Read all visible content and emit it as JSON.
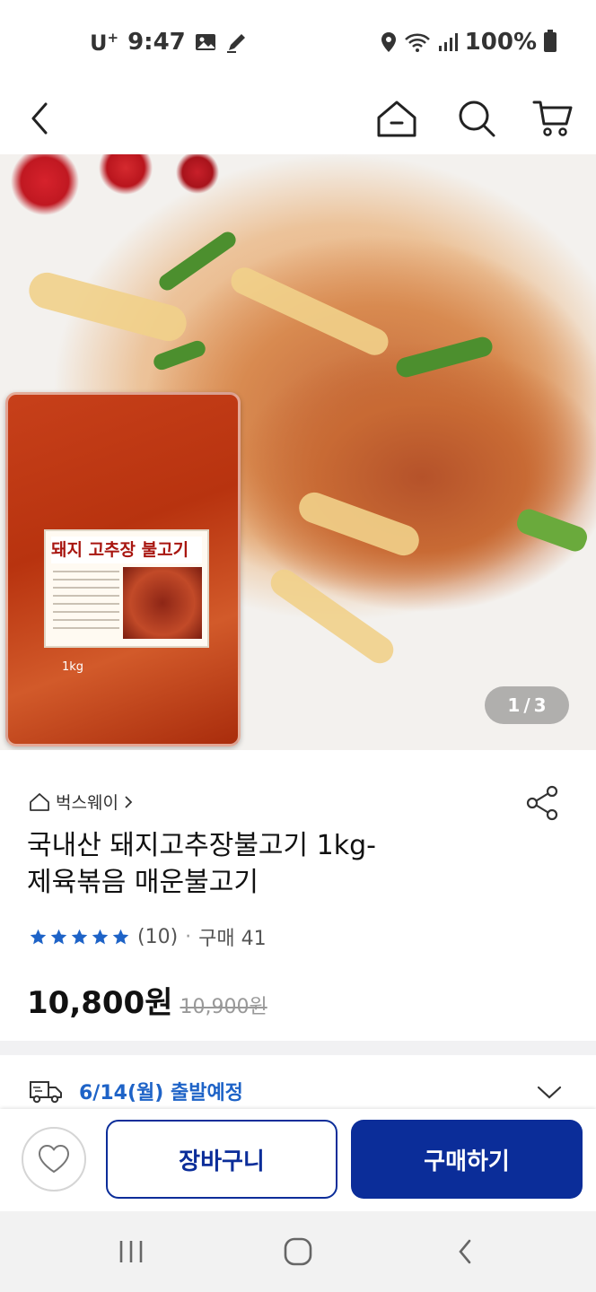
{
  "status_bar": {
    "carrier": "U",
    "carrier_sup": "+",
    "time": "9:47",
    "battery": "100%",
    "icons": [
      "gallery-icon",
      "pen-icon",
      "location-icon",
      "wifi-icon",
      "signal-icon",
      "battery-icon"
    ]
  },
  "top_nav": {
    "icons": [
      "back-icon",
      "home-icon",
      "search-icon",
      "cart-icon"
    ]
  },
  "hero": {
    "package_title": "돼지 고추장 불고기",
    "package_weight": "1kg",
    "page_current": "1",
    "page_separator": "/",
    "page_total": "3"
  },
  "product": {
    "brand": "벅스웨이",
    "title_line1": "국내산 돼지고추장불고기 1kg-",
    "title_line2": "제육볶음 매운불고기",
    "rating_stars": 5,
    "review_count": "(10)",
    "dot": "·",
    "purchase_label": "구매 41",
    "price": "10,800원",
    "original_price": "10,900원",
    "star_color": "#1e63c7"
  },
  "delivery": {
    "text": "6/14(월) 출발예정",
    "color": "#1e63c7"
  },
  "actions": {
    "cart_label": "장바구니",
    "buy_label": "구매하기",
    "accent": "#0b2d99"
  },
  "system_nav": {
    "icons": [
      "recent-apps-icon",
      "home-circle-icon",
      "system-back-icon"
    ]
  }
}
